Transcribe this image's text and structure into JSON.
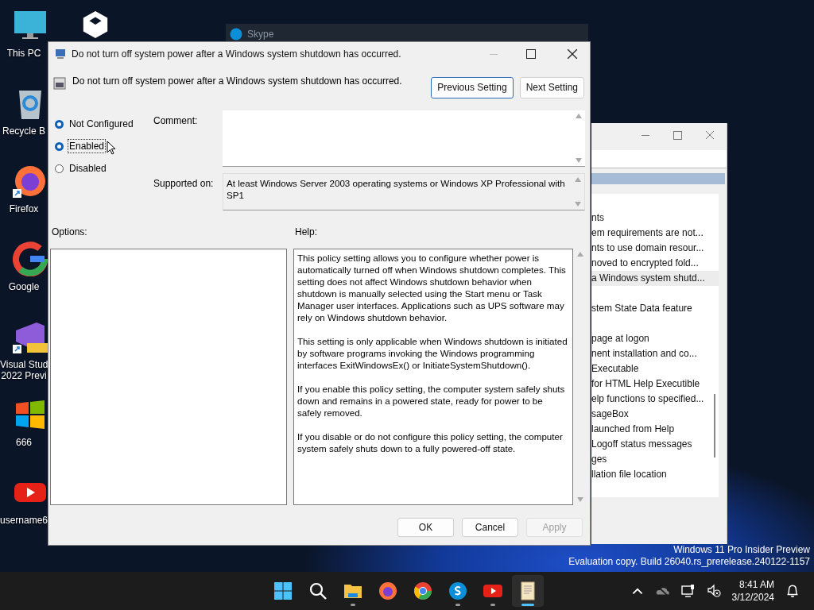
{
  "desktop_icons": [
    {
      "kind": "monitor",
      "label": "This PC"
    },
    {
      "kind": "recycle",
      "label": "Recycle B"
    },
    {
      "kind": "firefox",
      "label": "Firefox",
      "shortcut": true
    },
    {
      "kind": "google",
      "label": "Google"
    },
    {
      "kind": "vs",
      "label": "Visual Stud\n2022 Previ",
      "shortcut": true
    },
    {
      "kind": "windows",
      "label": "666"
    },
    {
      "kind": "youtube",
      "label": "username6"
    }
  ],
  "skype_window": {
    "title": "Skype"
  },
  "background_window": {
    "items": [
      {
        "text": "nts",
        "selected": false
      },
      {
        "text": "em requirements are not...",
        "selected": false
      },
      {
        "text": "nts to use domain resour...",
        "selected": false
      },
      {
        "text": "noved to encrypted fold...",
        "selected": false
      },
      {
        "text": "a Windows system shutd...",
        "selected": true
      },
      {
        "selected": false
      },
      {
        "text": "stem State Data feature",
        "selected": false
      },
      {
        "selected": false
      },
      {
        "text": "page at logon",
        "selected": false
      },
      {
        "text": "nent installation and co...",
        "selected": false
      },
      {
        "text": "Executable",
        "selected": false
      },
      {
        "text": "for HTML Help Executible",
        "selected": false
      },
      {
        "text": "elp functions to specified...",
        "selected": false
      },
      {
        "text": "sageBox",
        "selected": false
      },
      {
        "text": "launched from Help",
        "selected": false
      },
      {
        "text": "Logoff status messages",
        "selected": false
      },
      {
        "text": "ges",
        "selected": false
      },
      {
        "text": "llation file location",
        "selected": false
      }
    ]
  },
  "dialog": {
    "title": "Do not turn off system power after a Windows system shutdown has occurred.",
    "setting_name": "Do not turn off system power after a Windows system shutdown has occurred.",
    "nav_buttons": [
      {
        "label": "Previous Setting",
        "focused": true
      },
      {
        "label": "Next Setting",
        "focused": false
      }
    ],
    "options": [
      {
        "label": "Not Configured",
        "selected": true,
        "focused": false
      },
      {
        "label": "Enabled",
        "selected": true,
        "focused": true
      },
      {
        "label": "Disabled",
        "selected": false,
        "focused": false
      }
    ],
    "comment_label": "Comment:",
    "supported_label": "Supported on:",
    "supported_text": "At least Windows Server 2003 operating systems or Windows XP Professional with SP1",
    "options_label": "Options:",
    "help_label": "Help:",
    "help_paragraphs": [
      "This policy setting allows you to configure whether power is automatically turned off when Windows shutdown completes. This setting does not affect Windows shutdown behavior when shutdown is manually selected using the Start menu or Task Manager user interfaces.  Applications such as UPS software may rely on Windows shutdown behavior.",
      "This setting is only applicable when Windows shutdown is initiated by software programs invoking the Windows programming interfaces ExitWindowsEx() or InitiateSystemShutdown().",
      "If you enable this policy setting, the computer system safely shuts down and remains in a powered state, ready for power to be safely removed.",
      "If you disable or do not configure this policy setting, the computer system safely shuts down to a fully powered-off state."
    ],
    "buttons": [
      {
        "label": "OK",
        "disabled": false
      },
      {
        "label": "Cancel",
        "disabled": false
      },
      {
        "label": "Apply",
        "disabled": true
      }
    ]
  },
  "watermark": [
    "Windows 11 Pro Insider Preview",
    "Evaluation copy. Build 26040.rs_prerelease.240122-1157"
  ],
  "taskbar": {
    "apps": [
      {
        "kind": "start",
        "running": false,
        "active": false
      },
      {
        "kind": "search",
        "running": false,
        "active": false
      },
      {
        "kind": "folder",
        "running": true,
        "active": false
      },
      {
        "kind": "firefox",
        "running": false,
        "active": false
      },
      {
        "kind": "chrome",
        "running": false,
        "active": false
      },
      {
        "kind": "skype",
        "running": true,
        "active": false
      },
      {
        "kind": "youtube",
        "running": true,
        "active": false
      },
      {
        "kind": "scroll",
        "running": true,
        "active": true
      }
    ],
    "time": "8:41 AM",
    "date": "3/12/2024"
  }
}
